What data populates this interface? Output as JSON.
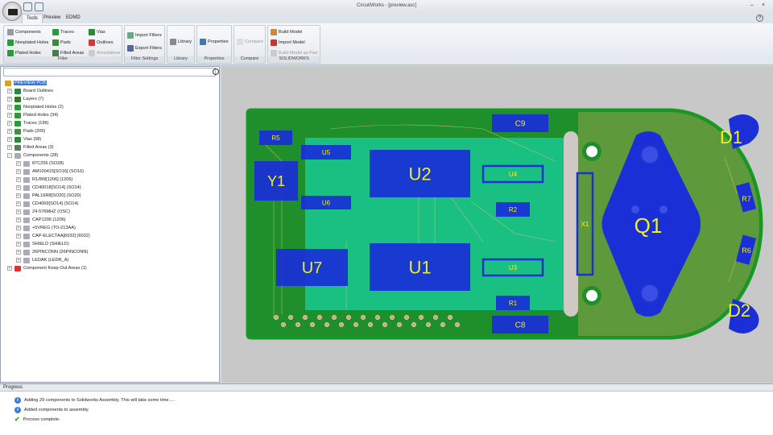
{
  "window": {
    "title": "CircuitWorks - [preview.asc]"
  },
  "tabs": [
    {
      "label": "Tools",
      "active": true
    },
    {
      "label": "Preview"
    },
    {
      "label": "EDMD"
    }
  ],
  "ribbon": {
    "filter": {
      "label": "Filter",
      "items": [
        "Components",
        "Nonplated Holes",
        "Plated Holes",
        "Traces",
        "Pads",
        "Filled Areas",
        "Vias",
        "Outlines",
        "Annotations"
      ]
    },
    "filter_settings": {
      "label": "Filter Settings",
      "items": [
        "Import Filters",
        "Export Filters"
      ]
    },
    "library": {
      "label": "Library",
      "button": "Library"
    },
    "properties": {
      "label": "Properties",
      "button": "Properties"
    },
    "compare": {
      "label": "Compare",
      "button": "Compare"
    },
    "solidworks": {
      "label": "SOLIDWORKS",
      "items": [
        "Build Model",
        "Import Model",
        "Build Model as Part"
      ]
    }
  },
  "tree": {
    "root": "PREVIEW PCB",
    "items": [
      "Board Outlines",
      "Layers (7)",
      "Nonplated Holes (2)",
      "Plated Holes (34)",
      "Traces (196)",
      "Pads (206)",
      "Vias (58)",
      "Filled Areas (3)",
      "Components (28)"
    ],
    "components": [
      "87C256 (SO28)",
      "AM100415[SO16] (SO16)",
      "R1/8W[1206] (1206)",
      "CD40018[SO14] (SO14)",
      "PAL16R8[SO20] (SO20)",
      "CD4069[SO14] (SO14)",
      "24-576MHZ (OSC)",
      "CAP1206 (1206)",
      "+5VREG (TO-213AA)",
      "CAP-ELECTAA[6032] (6032)",
      "SHIELD (SHIELD)",
      "26PINCONN (26PINCONN)",
      "LEDAK (LEDR_A)"
    ],
    "last": "Component Keep-Out Areas (1)"
  },
  "pcb": {
    "labels": {
      "R5": "R5",
      "Y1": "Y1",
      "U5": "U5",
      "U6": "U6",
      "U2": "U2",
      "U1": "U1",
      "U7": "U7",
      "C9": "C9",
      "C8": "C8",
      "U4": "U4",
      "U3": "U3",
      "R2": "R2",
      "R1": "R1",
      "X1": "X1",
      "Q1": "Q1",
      "D1": "D1",
      "D2": "D2",
      "R7": "R7",
      "R6": "R6"
    },
    "colors": {
      "board": "#1e8f2a",
      "copper_area": "#19c48a",
      "right_area": "#5e9a3c",
      "component": "#1a2fd6",
      "label": "#f2f01e"
    }
  },
  "progress": {
    "title": "Progress",
    "messages": [
      {
        "icon": "info-icon",
        "text": "Adding 29 components to Solidworks Assembly. This will take some time....."
      },
      {
        "icon": "info-icon",
        "text": "Added components to assembly."
      },
      {
        "icon": "check-icon",
        "text": "Process complete."
      }
    ]
  }
}
